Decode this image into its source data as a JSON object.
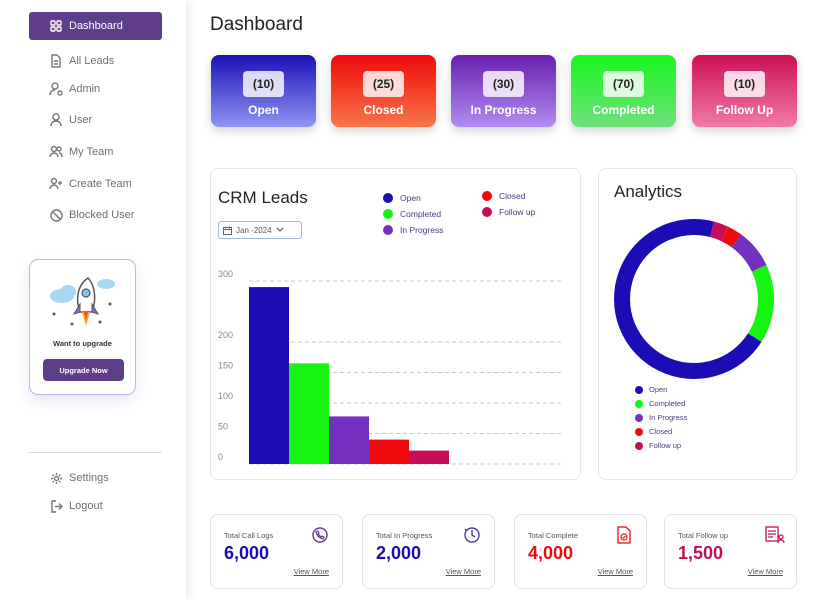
{
  "sidebar": {
    "items": [
      {
        "label": "Dashboard",
        "icon": "grid-icon",
        "active": true
      },
      {
        "label": "All Leads",
        "icon": "document-icon"
      },
      {
        "label": "Admin",
        "icon": "user-gear-icon"
      },
      {
        "label": "User",
        "icon": "user-icon"
      },
      {
        "label": "My Team",
        "icon": "users-icon"
      },
      {
        "label": "Create Team",
        "icon": "user-plus-icon"
      },
      {
        "label": "Blocked User",
        "icon": "block-icon"
      }
    ],
    "upgrade": {
      "text": "Want to upgrade",
      "button": "Upgrade Now"
    },
    "bottom_items": [
      {
        "label": "Settings",
        "icon": "gear-icon"
      },
      {
        "label": "Logout",
        "icon": "logout-icon"
      }
    ]
  },
  "page_title": "Dashboard",
  "stat_cards": [
    {
      "count": "(10)",
      "label": "Open",
      "gradient": [
        "#1b11b8",
        "#8e95f2"
      ]
    },
    {
      "count": "(25)",
      "label": "Closed",
      "gradient": [
        "#ee0a0a",
        "#f7764a"
      ]
    },
    {
      "count": "(30)",
      "label": "In Progress",
      "gradient": [
        "#6a1fb0",
        "#b08cf0"
      ]
    },
    {
      "count": "(70)",
      "label": "Completed",
      "gradient": [
        "#19f51f",
        "#6fe07a"
      ]
    },
    {
      "count": "(10)",
      "label": "Follow Up",
      "gradient": [
        "#cc1055",
        "#f27aa8"
      ]
    }
  ],
  "crm": {
    "title": "CRM Leads",
    "month": "Jan -2024"
  },
  "analytics": {
    "title": "Analytics"
  },
  "colors": {
    "open": "#1b0cb5",
    "completed": "#16f411",
    "in_progress": "#7530bf",
    "closed": "#ee0b0b",
    "follow_up": "#c40e57",
    "brand": "#5e3d8a"
  },
  "chart_data": [
    {
      "type": "bar",
      "title": "CRM Leads",
      "categories": [
        "Open",
        "Completed",
        "In Progress",
        "Closed",
        "Follow up"
      ],
      "values": [
        290,
        165,
        78,
        40,
        22
      ],
      "colors": [
        "#1b0cb5",
        "#16f411",
        "#7530bf",
        "#ee0b0b",
        "#c40e57"
      ],
      "yticks": [
        0,
        50,
        100,
        150,
        200,
        300
      ],
      "ylim": [
        0,
        300
      ],
      "grid": true,
      "legend_position": "top-right"
    },
    {
      "type": "pie",
      "title": "Analytics",
      "categories": [
        "Open",
        "Completed",
        "In Progress",
        "Closed",
        "Follow up"
      ],
      "values": [
        70,
        16,
        8,
        3,
        3
      ],
      "colors": [
        "#1b0cb5",
        "#16f411",
        "#7530bf",
        "#ee0b0b",
        "#c40e57"
      ],
      "donut": true,
      "legend_position": "bottom"
    }
  ],
  "bottom_cards": [
    {
      "label": "Total Call Logs",
      "value": "6,000",
      "link": "View More",
      "color": "#1b0cb5",
      "icon": "call-log-icon"
    },
    {
      "label": "Total In Progress",
      "value": "2,000",
      "link": "View More",
      "color": "#1b0cb5",
      "icon": "progress-icon"
    },
    {
      "label": "Total Complete",
      "value": "4,000",
      "link": "View More",
      "color": "#ee0b0b",
      "icon": "complete-doc-icon"
    },
    {
      "label": "Total Follow up",
      "value": "1,500",
      "link": "View More",
      "color": "#c40e57",
      "icon": "follow-up-icon"
    }
  ]
}
